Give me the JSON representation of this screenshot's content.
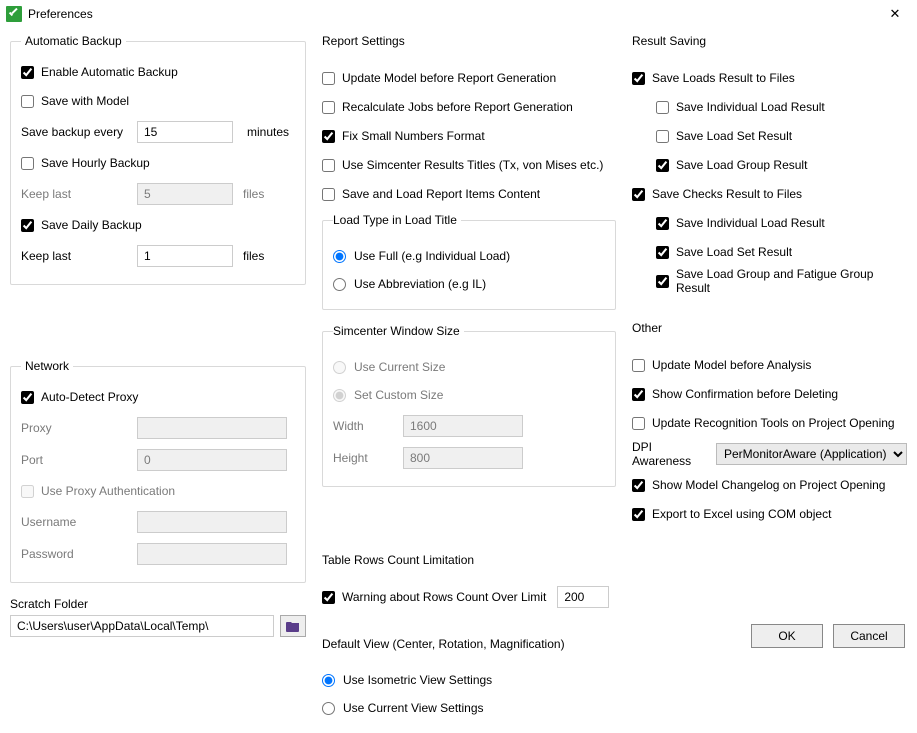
{
  "window": {
    "title": "Preferences",
    "close_icon": "✕"
  },
  "backup": {
    "legend": "Automatic Backup",
    "enable": {
      "label": "Enable Automatic Backup",
      "checked": true
    },
    "save_with_model": {
      "label": "Save with Model",
      "checked": false
    },
    "save_every_label": "Save backup every",
    "save_every_value": "15",
    "save_every_unit": "minutes",
    "hourly": {
      "label": "Save Hourly Backup",
      "checked": false
    },
    "keep_last_hourly_label": "Keep last",
    "keep_last_hourly_value": "5",
    "keep_last_hourly_unit": "files",
    "daily": {
      "label": "Save Daily Backup",
      "checked": true
    },
    "keep_last_daily_label": "Keep last",
    "keep_last_daily_value": "1",
    "keep_last_daily_unit": "files"
  },
  "network": {
    "legend": "Network",
    "auto_detect": {
      "label": "Auto-Detect Proxy",
      "checked": true
    },
    "proxy_label": "Proxy",
    "proxy_value": "",
    "port_label": "Port",
    "port_value": "0",
    "use_auth": {
      "label": "Use Proxy Authentication",
      "checked": false
    },
    "username_label": "Username",
    "username_value": "",
    "password_label": "Password",
    "password_value": ""
  },
  "scratch": {
    "label": "Scratch Folder",
    "value": "C:\\Users\\user\\AppData\\Local\\Temp\\",
    "browse_icon": "folder"
  },
  "report": {
    "legend": "Report Settings",
    "update_model": {
      "label": "Update Model before Report Generation",
      "checked": false
    },
    "recalculate": {
      "label": "Recalculate Jobs before Report Generation",
      "checked": false
    },
    "fix_small": {
      "label": "Fix Small Numbers Format",
      "checked": true
    },
    "simcenter_titles": {
      "label": "Use Simcenter Results Titles (Tx, von Mises etc.)",
      "checked": false
    },
    "save_load_items": {
      "label": "Save and Load Report Items Content",
      "checked": false
    },
    "load_type_legend": "Load Type in Load Title",
    "load_type_full": "Use Full (e.g Individual Load)",
    "load_type_abbr": "Use Abbreviation (e.g IL)",
    "simcenter_win_legend": "Simcenter Window Size",
    "win_current": "Use Current Size",
    "win_custom": "Set Custom Size",
    "width_label": "Width",
    "width_value": "1600",
    "height_label": "Height",
    "height_value": "800"
  },
  "rows_limit": {
    "legend": "Table Rows Count Limitation",
    "warning": {
      "label": "Warning about Rows Count Over Limit",
      "checked": true
    },
    "value": "200"
  },
  "default_view": {
    "legend": "Default View (Center, Rotation, Magnification)",
    "isometric": "Use Isometric View Settings",
    "current": "Use Current View Settings"
  },
  "result_saving": {
    "legend": "Result Saving",
    "loads_files": {
      "label": "Save Loads Result to Files",
      "checked": true
    },
    "loads_individual": {
      "label": "Save Individual Load Result",
      "checked": false
    },
    "loads_set": {
      "label": "Save Load Set Result",
      "checked": false
    },
    "loads_group": {
      "label": "Save Load Group Result",
      "checked": true
    },
    "checks_files": {
      "label": "Save Checks Result to Files",
      "checked": true
    },
    "checks_individual": {
      "label": "Save Individual Load Result",
      "checked": true
    },
    "checks_set": {
      "label": "Save Load Set Result",
      "checked": true
    },
    "checks_group_fatigue": {
      "label": "Save Load Group and Fatigue Group Result",
      "checked": true
    }
  },
  "other": {
    "legend": "Other",
    "update_before_analysis": {
      "label": "Update Model before Analysis",
      "checked": false
    },
    "confirm_delete": {
      "label": "Show Confirmation before Deleting",
      "checked": true
    },
    "update_recog": {
      "label": "Update Recognition Tools on Project Opening",
      "checked": false
    },
    "dpi_label": "DPI Awareness",
    "dpi_value": "PerMonitorAware (Application)",
    "show_changelog": {
      "label": "Show Model Changelog on Project Opening",
      "checked": true
    },
    "export_com": {
      "label": "Export to Excel using COM object",
      "checked": true
    }
  },
  "buttons": {
    "ok": "OK",
    "cancel": "Cancel"
  }
}
